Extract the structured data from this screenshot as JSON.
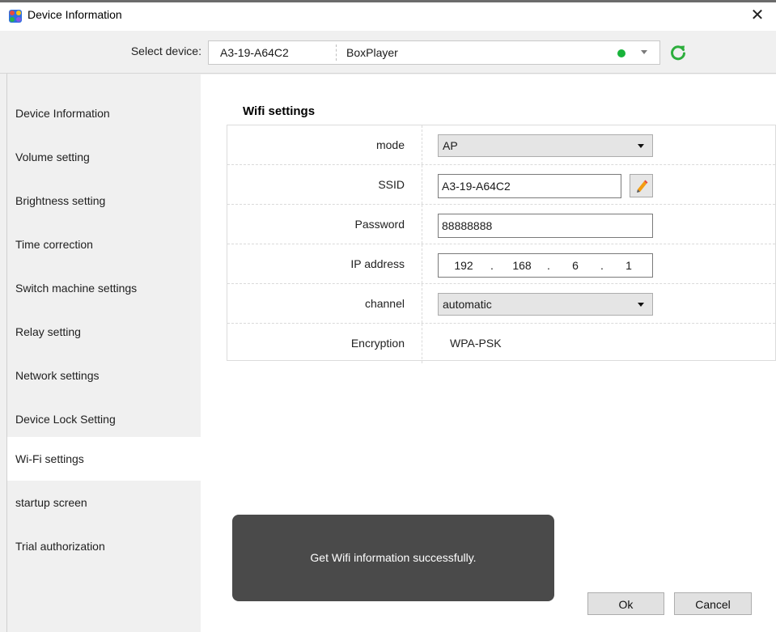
{
  "window": {
    "title": "Device Information",
    "close_glyph": "✕"
  },
  "device_bar": {
    "label": "Select device:",
    "device_id": "A3-19-A64C2",
    "device_name": "BoxPlayer",
    "status_color": "#18b33a"
  },
  "sidebar": {
    "items": [
      {
        "label": "Device Information"
      },
      {
        "label": "Volume setting"
      },
      {
        "label": "Brightness setting"
      },
      {
        "label": "Time correction"
      },
      {
        "label": "Switch machine settings"
      },
      {
        "label": "Relay setting"
      },
      {
        "label": "Network settings"
      },
      {
        "label": "Device Lock Setting"
      },
      {
        "label": "Wi-Fi settings",
        "active": true
      },
      {
        "label": "startup screen"
      },
      {
        "label": "Trial authorization"
      }
    ]
  },
  "wifi": {
    "section_title": "Wifi settings",
    "mode": {
      "label": "mode",
      "value": "AP"
    },
    "ssid": {
      "label": "SSID",
      "value": "A3-19-A64C2"
    },
    "password": {
      "label": "Password",
      "value": "88888888"
    },
    "ip": {
      "label": "IP address",
      "octets": [
        "192",
        "168",
        "6",
        "1"
      ]
    },
    "channel": {
      "label": "channel",
      "value": "automatic"
    },
    "encryption": {
      "label": "Encryption",
      "value": "WPA-PSK"
    }
  },
  "toast": {
    "message": "Get Wifi information successfully."
  },
  "buttons": {
    "ok": "Ok",
    "cancel": "Cancel"
  }
}
